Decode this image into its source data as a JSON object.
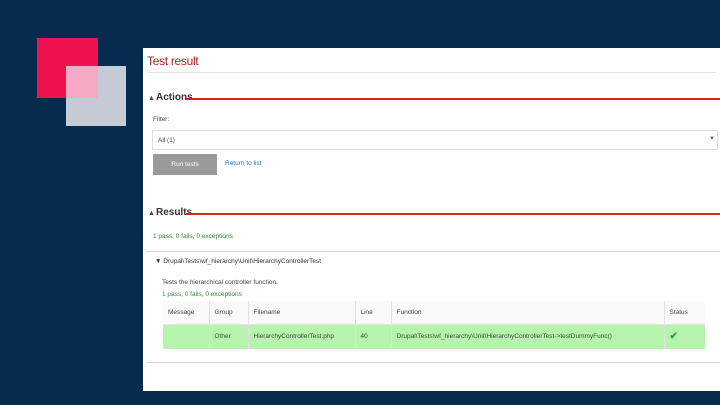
{
  "page": {
    "title": "Test result"
  },
  "actions": {
    "legend": "Actions",
    "filter_label": "Filter:",
    "filter_value": "All (1)",
    "run_button": "Run tests",
    "return_link": "Return to list"
  },
  "results": {
    "legend": "Results",
    "summary": "1 pass, 0 fails, 0 exceptions",
    "group": {
      "heading": "▼ Drupal\\Tests\\wf_hierarchy\\Unit\\HierarchyControllerTest",
      "description": "Tests the hierarchical controller function.",
      "summary": "1 pass, 0 fails, 0 exceptions"
    },
    "columns": [
      "Message",
      "Group",
      "Filename",
      "Line",
      "Function",
      "Status"
    ],
    "rows": [
      {
        "message": "",
        "group": "Other",
        "filename": "HierarchyControllerTest.php",
        "line": "40",
        "function": "Drupal\\Tests\\wf_hierarchy\\Unit\\HierarchyControllerTest->testDummyFunc()",
        "status_icon": "check-icon",
        "status_glyph": "✔"
      }
    ]
  },
  "colors": {
    "background": "#062b4f",
    "accent_red": "#dd2222",
    "pass_green": "#b6f4ae",
    "deco_pink": "#f0124f",
    "deco_grey": "#c5cbd5"
  }
}
